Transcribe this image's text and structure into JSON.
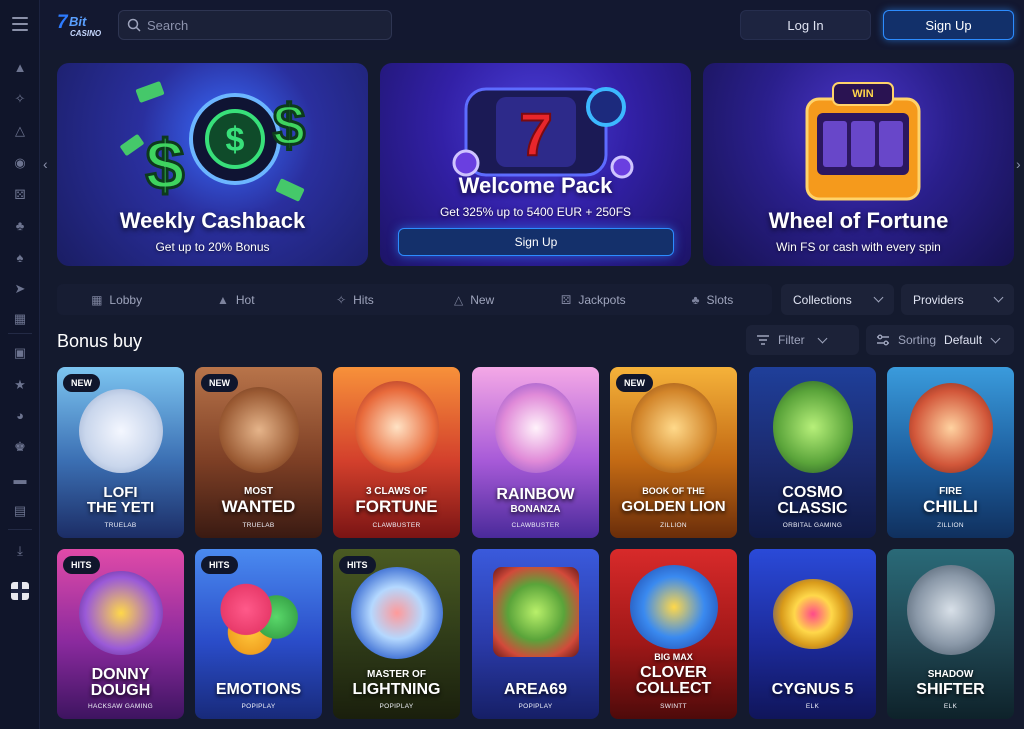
{
  "header": {
    "logo_text": "7Bit CASINO",
    "search_placeholder": "Search",
    "login_label": "Log In",
    "signup_label": "Sign Up"
  },
  "sidebar": {
    "icons": [
      "fire-icon",
      "puzzle-icon",
      "flame-icon",
      "target-icon",
      "dice-icon",
      "cherry-icon",
      "card-icon",
      "rocket-icon",
      "book-icon",
      "gift-icon",
      "trophy-icon",
      "robot-icon",
      "crown-icon",
      "wallet-icon",
      "briefcase-icon",
      "download-icon",
      "language-flag-icon"
    ]
  },
  "banners": [
    {
      "title": "Weekly Cashback",
      "subtitle": "Get up to 20% Bonus"
    },
    {
      "title": "Welcome Pack",
      "subtitle": "Get 325% up to 5400 EUR + 250FS",
      "cta": "Sign Up"
    },
    {
      "title": "Wheel of Fortune",
      "subtitle": "Win FS or cash with every spin",
      "badge": "WIN"
    }
  ],
  "categories": [
    {
      "label": "Lobby",
      "icon": "lobby-icon"
    },
    {
      "label": "Hot",
      "icon": "fire-icon"
    },
    {
      "label": "Hits",
      "icon": "puzzle-icon"
    },
    {
      "label": "New",
      "icon": "flame-icon"
    },
    {
      "label": "Jackpots",
      "icon": "dice-icon"
    },
    {
      "label": "Slots",
      "icon": "cherry-icon"
    }
  ],
  "dropdowns": {
    "collections": "Collections",
    "providers": "Providers"
  },
  "section": {
    "title": "Bonus buy",
    "filter_label": "Filter",
    "sorting_label": "Sorting",
    "sorting_value": "Default"
  },
  "games": [
    {
      "badge": "NEW",
      "line1": "LOFI",
      "line2": "THE YETI",
      "provider": "TRUELAB"
    },
    {
      "badge": "NEW",
      "line1": "MOST",
      "line2": "WANTED",
      "provider": "TRUELAB"
    },
    {
      "badge": "",
      "line1": "3 CLAWS OF",
      "line2": "FORTUNE",
      "provider": "CLAWBUSTER"
    },
    {
      "badge": "",
      "line1": "RAINBOW",
      "line2": "BONANZA",
      "provider": "CLAWBUSTER"
    },
    {
      "badge": "NEW",
      "line1": "BOOK OF THE",
      "line2": "GOLDEN LION",
      "provider": "ZILLION"
    },
    {
      "badge": "",
      "line1": "COSMO",
      "line2": "CLASSIC",
      "provider": "ORBITAL GAMING"
    },
    {
      "badge": "",
      "line1": "FIRE",
      "line2": "CHILLI",
      "provider": "ZILLION"
    },
    {
      "badge": "HITS",
      "line1": "DONNY",
      "line2": "DOUGH",
      "provider": "HACKSAW GAMING"
    },
    {
      "badge": "HITS",
      "line1": "",
      "line2": "EMOTIONS",
      "provider": "POPIPLAY"
    },
    {
      "badge": "HITS",
      "line1": "MASTER OF",
      "line2": "LIGHTNING",
      "provider": "POPIPLAY"
    },
    {
      "badge": "",
      "line1": "",
      "line2": "AREA69",
      "provider": "POPIPLAY"
    },
    {
      "badge": "",
      "line1": "BIG MAX",
      "line2": "CLOVER COLLECT",
      "provider": "SWINTT"
    },
    {
      "badge": "",
      "line1": "",
      "line2": "CYGNUS 5",
      "provider": "ELK"
    },
    {
      "badge": "",
      "line1": "SHADOW",
      "line2": "SHIFTER",
      "provider": "ELK"
    }
  ]
}
